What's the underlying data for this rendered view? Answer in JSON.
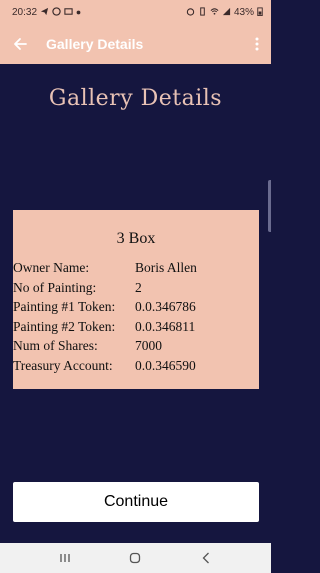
{
  "status_bar": {
    "time": "20:32",
    "left_icons": [
      "telegram-icon",
      "messenger-icon",
      "cast-icon",
      "dot-icon"
    ],
    "battery": "43%",
    "right_icons": [
      "alarm-icon",
      "vibrate-icon",
      "wifi-icon",
      "signal-icon",
      "battery-icon"
    ]
  },
  "app_bar": {
    "back_icon": "back-arrow-icon",
    "title": "Gallery Details",
    "menu_icon": "overflow-menu-icon"
  },
  "heading": "Gallery Details",
  "card": {
    "title": "3 Box",
    "rows": [
      {
        "label": "Owner Name:",
        "value": "Boris Allen"
      },
      {
        "label": "No of Painting:",
        "value": "2"
      },
      {
        "label": "Painting #1 Token:",
        "value": "0.0.346786"
      },
      {
        "label": "Painting #2 Token:",
        "value": "0.0.346811"
      },
      {
        "label": "Num of Shares:",
        "value": "7000"
      },
      {
        "label": "Treasury Account:",
        "value": "0.0.346590"
      }
    ]
  },
  "continue_label": "Continue",
  "nav_bar": [
    "recent-apps-icon",
    "home-icon",
    "back-icon"
  ],
  "colors": {
    "accent": "#f2c3b0",
    "background": "#15163f",
    "heading": "#e8c2b5",
    "button": "#ffffff"
  }
}
